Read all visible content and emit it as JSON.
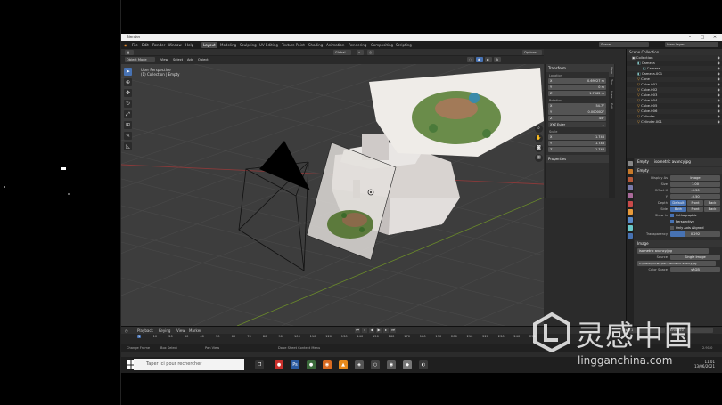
{
  "window": {
    "title": "Blender",
    "controls": [
      "–",
      "□",
      "✕"
    ]
  },
  "menubar": {
    "items": [
      "File",
      "Edit",
      "Render",
      "Window",
      "Help"
    ],
    "workspaces": [
      "Layout",
      "Modeling",
      "Sculpting",
      "UV Editing",
      "Texture Paint",
      "Shading",
      "Animation",
      "Rendering",
      "Compositing",
      "Scripting"
    ],
    "active_workspace": "Layout",
    "scene_label": "Scene",
    "view_layer_label": "View Layer"
  },
  "tool_header": {
    "orientation": "Global",
    "options_label": "Options"
  },
  "viewport_header": {
    "mode": "Object Mode",
    "menus": [
      "View",
      "Select",
      "Add",
      "Object"
    ]
  },
  "viewport": {
    "info_line1": "User Perspective",
    "info_line2": "(1) Collection | Empty",
    "tools": [
      "select",
      "cursor",
      "move",
      "rotate",
      "scale",
      "transform",
      "annotate",
      "measure"
    ],
    "colors": {
      "background": "#3d3d3d",
      "grid": "#4a4a4a",
      "x_axis": "#8a3a3a",
      "y_axis": "#6a8a2a"
    }
  },
  "npanel": {
    "section": "Transform",
    "location_label": "Location",
    "location": [
      [
        "X",
        "0.69227 m"
      ],
      [
        "Y",
        "0 m"
      ],
      [
        "Z",
        "1.7362 m"
      ]
    ],
    "rotation_label": "Rotation",
    "rotation": [
      [
        "X",
        "54.7°"
      ],
      [
        "Y",
        "0.000002°"
      ],
      [
        "Z",
        "45°"
      ]
    ],
    "rotation_mode": "XYZ Euler",
    "scale_label": "Scale",
    "scale": [
      [
        "X",
        "1.748"
      ],
      [
        "Y",
        "1.748"
      ],
      [
        "Z",
        "1.748"
      ]
    ],
    "properties_label": "Properties",
    "tabs": [
      "Item",
      "Tool",
      "View",
      "Edit"
    ]
  },
  "outliner": {
    "header": "Scene Collection",
    "rows": [
      {
        "name": "Collection",
        "kind": "collection"
      },
      {
        "name": "Camera",
        "kind": "camera"
      },
      {
        "name": "Camera",
        "kind": "camera-data"
      },
      {
        "name": "Camera.001",
        "kind": "camera"
      },
      {
        "name": "Cone",
        "kind": "mesh"
      },
      {
        "name": "Cube.001",
        "kind": "mesh"
      },
      {
        "name": "Cube.002",
        "kind": "mesh"
      },
      {
        "name": "Cube.003",
        "kind": "mesh"
      },
      {
        "name": "Cube.004",
        "kind": "mesh"
      },
      {
        "name": "Cube.005",
        "kind": "mesh"
      },
      {
        "name": "Cube.006",
        "kind": "mesh"
      },
      {
        "name": "Cylinder",
        "kind": "mesh"
      },
      {
        "name": "Cylinder.001",
        "kind": "mesh"
      }
    ]
  },
  "properties": {
    "object_name": "Empty",
    "image_name": "isometric avancy.jpg",
    "empty_section": "Empty",
    "display_as_label": "Display As",
    "display_as": "Image",
    "size_label": "Size",
    "size": "1.00",
    "offset_x_label": "Offset X",
    "offset_x": "-0.50",
    "offset_y_label": "Y",
    "offset_y": "-0.50",
    "depth_label": "Depth",
    "depth_options": [
      "Default",
      "Front",
      "Back"
    ],
    "side_label": "Side",
    "side_options": [
      "Both",
      "Front",
      "Back"
    ],
    "show_in_label": "Show in",
    "show_orthographic": "Orthographic",
    "show_perspective": "Perspective",
    "only_axis_aligned": "Only Axis Aligned",
    "transparency_label": "Transparency",
    "transparency": "0.292",
    "image_section": "Image",
    "image_file": "isometric avancy.jpg",
    "source_label": "Source",
    "source": "Single Image",
    "filepath": "C:\\Users\\vincent\\De...\\isometric avancy.jpg",
    "color_space_label": "Color Space",
    "color_space": "sRGB"
  },
  "timeline": {
    "menus": [
      "Playback",
      "Keying",
      "View",
      "Marker"
    ],
    "ticks": [
      "1",
      "10",
      "20",
      "30",
      "40",
      "50",
      "60",
      "70",
      "80",
      "90",
      "100",
      "110",
      "120",
      "130",
      "140",
      "150",
      "160",
      "170",
      "180",
      "190",
      "200",
      "210",
      "220",
      "230",
      "240",
      "250"
    ],
    "current_frame": "1",
    "start_label": "Start",
    "end_label": "End",
    "start": "1",
    "end": "250"
  },
  "statusbar": {
    "items": [
      "Change Frame",
      "Box Select",
      "Pan View",
      "Dope Sheet Context Menu"
    ],
    "version": "2.91.0"
  },
  "taskbar": {
    "search_placeholder": "Taper ici pour rechercher",
    "time": "11:01",
    "date": "13/06/2021"
  },
  "watermark": {
    "cn": "灵感中国",
    "en": "lingganchina.com"
  }
}
